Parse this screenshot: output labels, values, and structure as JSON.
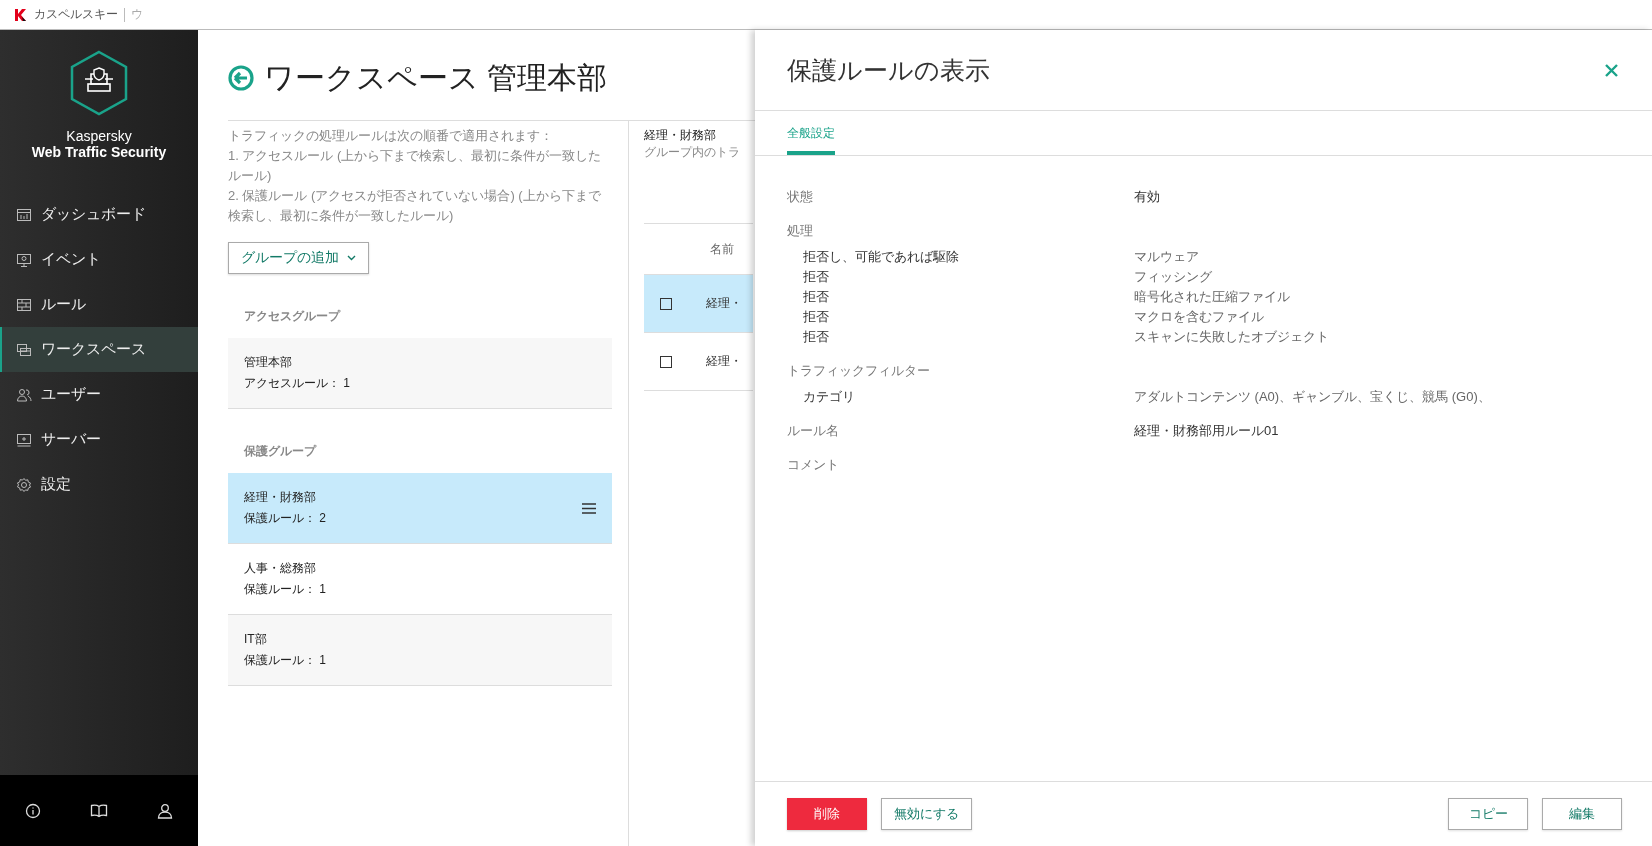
{
  "app_bar": {
    "title": "カスペルスキー",
    "tab_fragment": "ウ"
  },
  "sidebar": {
    "product_name": "Kaspersky",
    "product_subtitle": "Web Traffic Security",
    "items": [
      {
        "label": "ダッシュボード",
        "selected": false
      },
      {
        "label": "イベント",
        "selected": false
      },
      {
        "label": "ルール",
        "selected": false
      },
      {
        "label": "ワークスペース",
        "selected": true
      },
      {
        "label": "ユーザー",
        "selected": false
      },
      {
        "label": "サーバー",
        "selected": false
      },
      {
        "label": "設定",
        "selected": false
      }
    ]
  },
  "main": {
    "heading": "ワークスペース 管理本部",
    "description": [
      "トラフィックの処理ルールは次の順番で適用されます：",
      "1. アクセスルール (上から下まで検索し、最初に条件が一致したルール)",
      "2. 保護ルール (アクセスが拒否されていない場合) (上から下まで検索し、最初に条件が一致したルール)"
    ],
    "add_group_button": "グループの追加",
    "group_sections": [
      {
        "heading": "アクセスグループ",
        "items": [
          {
            "name": "管理本部",
            "detail": "アクセスルール： 1",
            "selected": false
          }
        ]
      },
      {
        "heading": "保護グループ",
        "items": [
          {
            "name": "経理・財務部",
            "detail": "保護ルール： 2",
            "selected": true
          },
          {
            "name": "人事・総務部",
            "detail": "保護ルール： 1",
            "selected": false
          },
          {
            "name": "IT部",
            "detail": "保護ルール： 1",
            "selected": false
          }
        ]
      }
    ]
  },
  "group_detail": {
    "name": "経理・財務部",
    "description": "グループ内のトラ",
    "columns": [
      "名前"
    ],
    "rows": [
      {
        "name": "経理・",
        "selected": true,
        "checked": false
      },
      {
        "name": "経理・",
        "selected": false,
        "checked": false
      }
    ]
  },
  "panel": {
    "title": "保護ルールの表示",
    "tabs": [
      {
        "label": "全般設定",
        "selected": true
      }
    ],
    "rows": [
      {
        "kind": "field",
        "label": "状態",
        "value": "有効"
      },
      {
        "kind": "section",
        "label": "処理",
        "items": [
          {
            "label": "拒否し、可能であれば駆除",
            "value": "マルウェア"
          },
          {
            "label": "拒否",
            "value": "フィッシング"
          },
          {
            "label": "拒否",
            "value": "暗号化された圧縮ファイル"
          },
          {
            "label": "拒否",
            "value": "マクロを含むファイル"
          },
          {
            "label": "拒否",
            "value": "スキャンに失敗したオブジェクト"
          }
        ]
      },
      {
        "kind": "section",
        "label": "トラフィックフィルター",
        "items": [
          {
            "label": "カテゴリ",
            "value": "アダルトコンテンツ (A0)、ギャンブル、宝くじ、競馬 (G0)、"
          }
        ]
      },
      {
        "kind": "field",
        "label": "ルール名",
        "value": "経理・財務部用ルール01"
      },
      {
        "kind": "field",
        "label": "コメント"
      }
    ],
    "left_buttons": [
      {
        "label": "削除",
        "kind": "danger"
      },
      {
        "label": "無効にする",
        "kind": "outline"
      }
    ],
    "right_buttons": [
      {
        "label": "コピー",
        "kind": "outline"
      },
      {
        "label": "編集",
        "kind": "outline"
      }
    ]
  }
}
